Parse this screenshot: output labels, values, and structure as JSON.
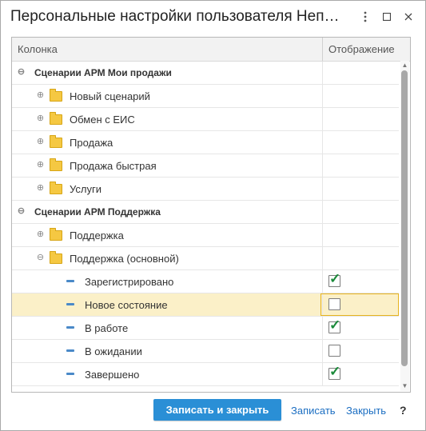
{
  "window": {
    "title": "Персональные настройки пользователя Неп…",
    "menu_icon": "more-vert-icon",
    "maximize_icon": "maximize-icon",
    "close_icon": "close-icon"
  },
  "grid": {
    "columns": {
      "column": "Колонка",
      "display": "Отображение"
    },
    "rows": [
      {
        "type": "group",
        "label": "Сценарии АРМ Мои продажи",
        "expander": "⊖"
      },
      {
        "type": "folder",
        "label": "Новый сценарий",
        "expander": "⊕"
      },
      {
        "type": "folder",
        "label": "Обмен с ЕИС",
        "expander": "⊕"
      },
      {
        "type": "folder",
        "label": "Продажа",
        "expander": "⊕"
      },
      {
        "type": "folder",
        "label": "Продажа быстрая",
        "expander": "⊕"
      },
      {
        "type": "folder",
        "label": "Услуги",
        "expander": "⊕"
      },
      {
        "type": "group",
        "label": "Сценарии АРМ Поддержка",
        "expander": "⊖"
      },
      {
        "type": "folder",
        "label": "Поддержка",
        "expander": "⊕"
      },
      {
        "type": "folder",
        "label": "Поддержка (основной)",
        "expander": "⊖"
      },
      {
        "type": "item",
        "label": "Зарегистрировано",
        "checked": true
      },
      {
        "type": "item",
        "label": "Новое состояние",
        "checked": false,
        "selected": true
      },
      {
        "type": "item",
        "label": "В работе",
        "checked": true
      },
      {
        "type": "item",
        "label": "В ожидании",
        "checked": false
      },
      {
        "type": "item",
        "label": "Завершено",
        "checked": true
      }
    ],
    "check_mark": "✓"
  },
  "footer": {
    "save_close": "Записать и закрыть",
    "save": "Записать",
    "close": "Закрыть",
    "help": "?"
  }
}
